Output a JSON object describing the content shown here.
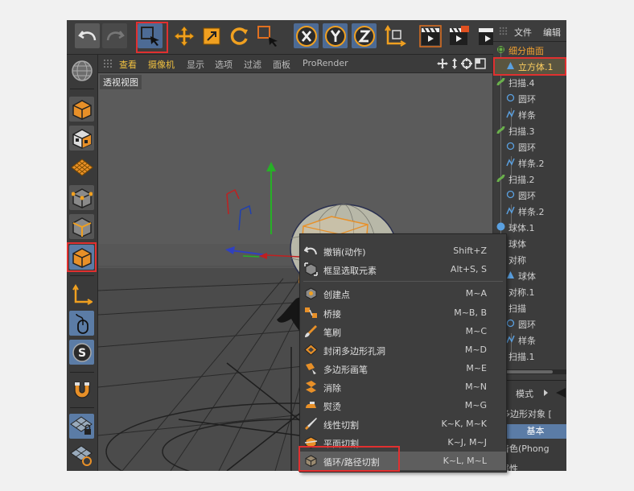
{
  "viewport": {
    "menu": {
      "view": "查看",
      "camera": "摄像机",
      "display": "显示",
      "options": "选项",
      "filter": "过滤",
      "panel": "面板",
      "prorender": "ProRender"
    },
    "label": "透视视图"
  },
  "object_manager": {
    "menu": {
      "file": "文件",
      "edit": "编辑"
    },
    "items": [
      {
        "name": "细分曲面"
      },
      {
        "name": "立方体.1"
      },
      {
        "name": "扫描.4"
      },
      {
        "name": "圆环"
      },
      {
        "name": "样条"
      },
      {
        "name": "扫描.3"
      },
      {
        "name": "圆环"
      },
      {
        "name": "样条.2"
      },
      {
        "name": "扫描.2"
      },
      {
        "name": "圆环"
      },
      {
        "name": "样条.2"
      },
      {
        "name": "球体.1"
      },
      {
        "name": "球体"
      },
      {
        "name": "对称"
      },
      {
        "name": "球体"
      },
      {
        "name": "对称.1"
      },
      {
        "name": "扫描"
      },
      {
        "name": "圆环"
      },
      {
        "name": "样条"
      },
      {
        "name": "扫描.1"
      }
    ]
  },
  "attribute_manager": {
    "mode": "模式",
    "object_type": "多边形对象 [",
    "tab_basic": "基本",
    "shading": "滑着色(Phong",
    "attrs": "本属性"
  },
  "context_menu": {
    "items": [
      {
        "label": "撤销(动作)",
        "shortcut": "Shift+Z"
      },
      {
        "label": "框显选取元素",
        "shortcut": "Alt+S, S"
      },
      {
        "label": "创建点",
        "shortcut": "M~A"
      },
      {
        "label": "桥接",
        "shortcut": "M~B, B"
      },
      {
        "label": "笔刷",
        "shortcut": "M~C"
      },
      {
        "label": "封闭多边形孔洞",
        "shortcut": "M~D"
      },
      {
        "label": "多边形画笔",
        "shortcut": "M~E"
      },
      {
        "label": "消除",
        "shortcut": "M~N"
      },
      {
        "label": "熨烫",
        "shortcut": "M~G"
      },
      {
        "label": "线性切割",
        "shortcut": "K~K, M~K"
      },
      {
        "label": "平面切割",
        "shortcut": "K~J, M~J"
      },
      {
        "label": "循环/路径切割",
        "shortcut": "K~L, M~L"
      }
    ]
  },
  "colors": {
    "highlight_box": "#e03030",
    "accent_blue": "#5b7ca6",
    "orange": "#f0a030"
  }
}
